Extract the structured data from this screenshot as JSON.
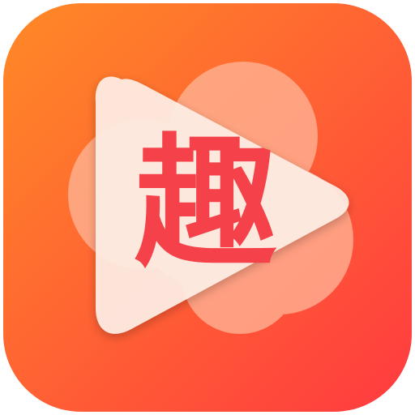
{
  "icon": {
    "glyph": "趣",
    "colors": {
      "gradient_start": "#FF8A26",
      "gradient_end": "#FF3A40",
      "petal_fill": "#FFB79A",
      "play_fill": "#FFEFE6",
      "glyph_fill": "#F5424A"
    }
  }
}
